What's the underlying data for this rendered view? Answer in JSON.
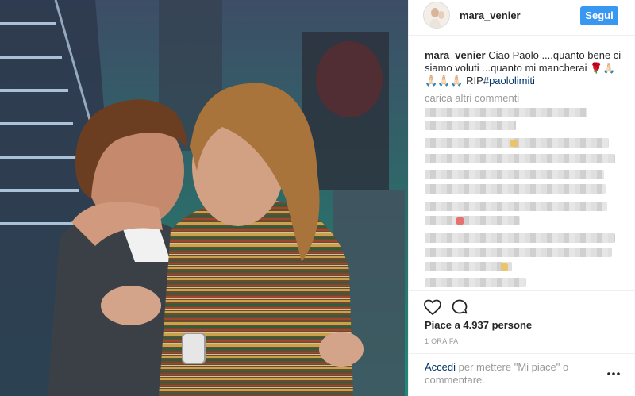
{
  "post": {
    "author": "mara_venier",
    "follow_label": "Segui",
    "caption_user": "mara_venier",
    "caption_text": " Ciao Paolo ....quanto bene ci siamo voluti ...quanto mi mancherai ",
    "caption_emoji_rose": "🌹",
    "caption_emoji_pray": "🙏🏻",
    "caption_emoji_pray_row": "🙏🏻🙏🏻🙏🏻 ",
    "caption_rip": "RIP",
    "hashtag": "#paololimiti",
    "load_more_label": "carica altri commenti",
    "likes_text": "Piace a 4.937 persone",
    "timestamp": "1 ORA FA",
    "login_link": "Accedi",
    "login_rest": " per mettere \"Mi piace\" o commentare."
  },
  "icons": {
    "like": "heart-outline",
    "comment": "speech-bubble",
    "more": "ellipsis-horizontal"
  },
  "colors": {
    "follow_button": "#3897f0",
    "link": "#003569",
    "muted_text": "#999999"
  }
}
